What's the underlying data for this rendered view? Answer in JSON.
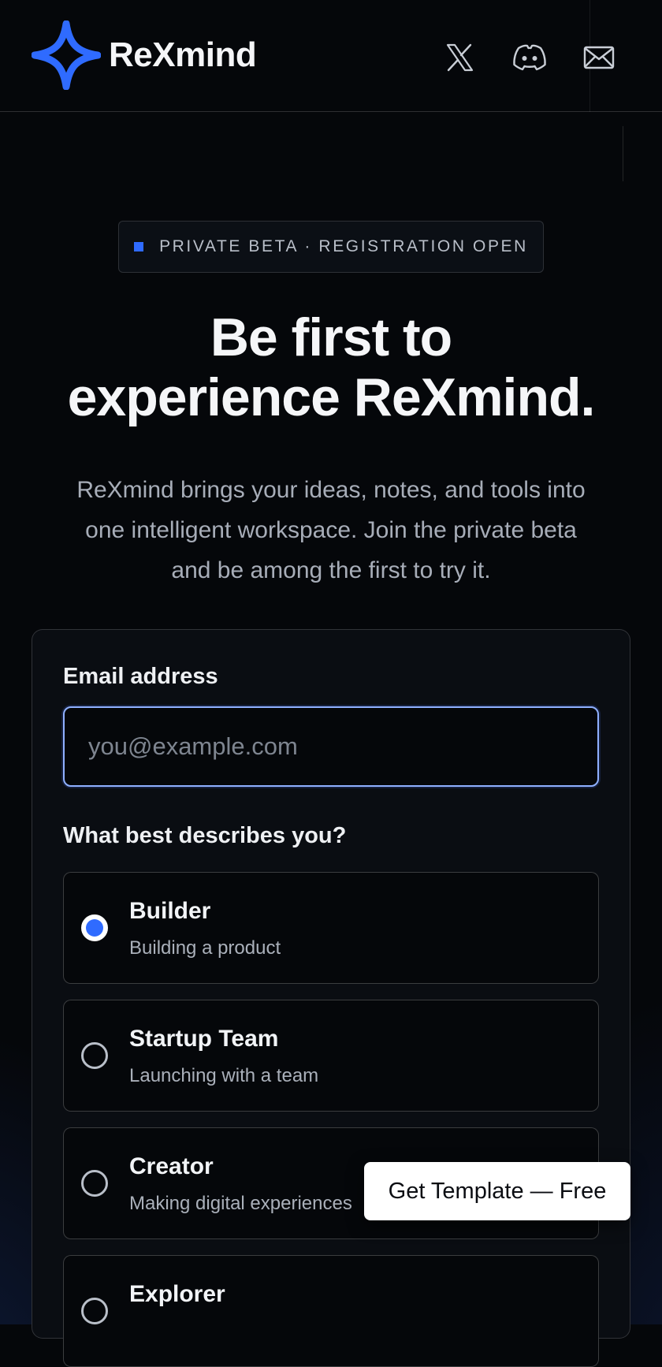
{
  "brand": {
    "name": "ReXmind",
    "accent": "#2f6bff"
  },
  "header": {
    "social": [
      {
        "icon": "x-icon"
      },
      {
        "icon": "discord-icon"
      },
      {
        "icon": "mail-icon"
      }
    ]
  },
  "badge": {
    "text": "PRIVATE BETA · REGISTRATION OPEN"
  },
  "hero": {
    "title_line1": "Be first to",
    "title_line2": "experience ReXmind.",
    "subtitle": "ReXmind brings your ideas, notes, and tools into one intelligent workspace. Join the private beta and be among the first to try it."
  },
  "form": {
    "email_label": "Email address",
    "email_placeholder": "you@example.com",
    "email_value": "",
    "role_question": "What best describes you?",
    "options": [
      {
        "title": "Builder",
        "desc": "Building a product",
        "selected": true
      },
      {
        "title": "Startup Team",
        "desc": "Launching with a team",
        "selected": false
      },
      {
        "title": "Creator",
        "desc": "Making digital experiences",
        "selected": false
      },
      {
        "title": "Explorer",
        "desc": "",
        "selected": false
      }
    ]
  },
  "cta": {
    "label": "Get Template — Free"
  }
}
